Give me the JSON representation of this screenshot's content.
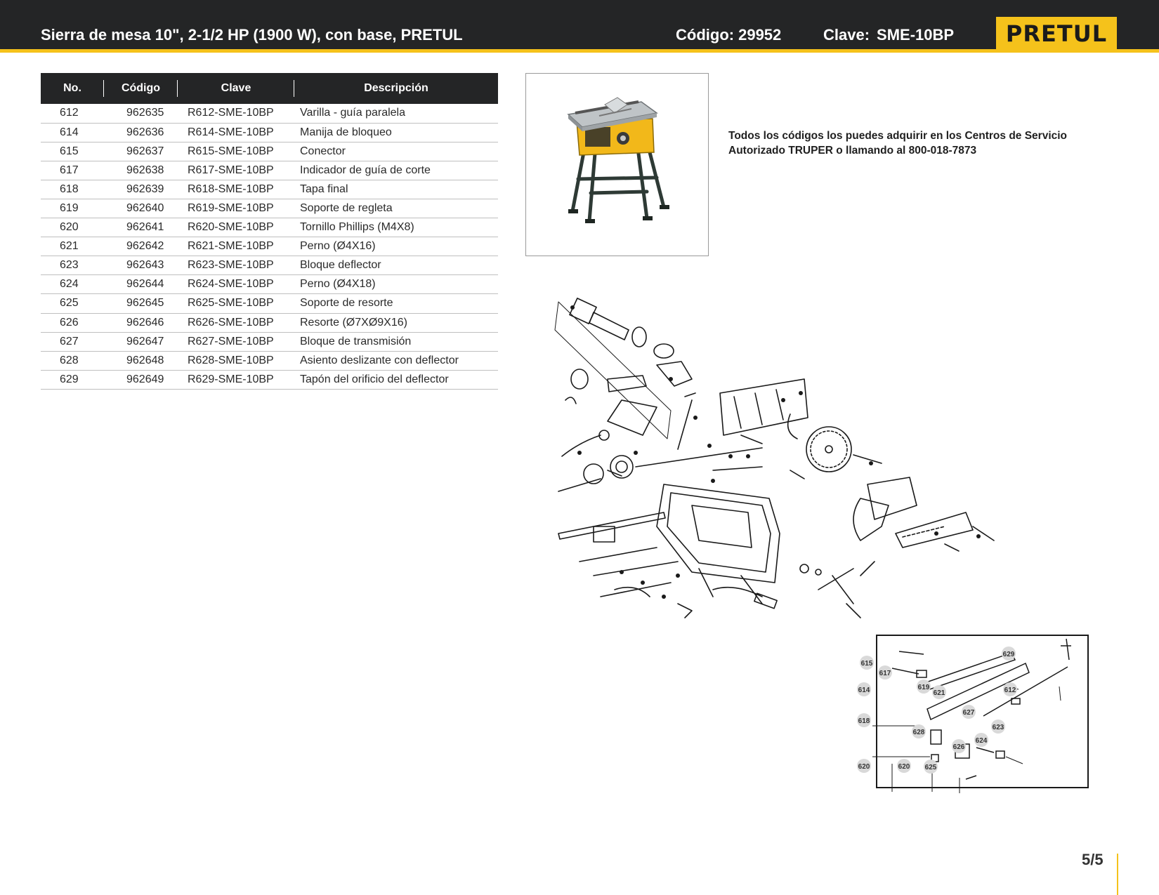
{
  "header": {
    "title": "Sierra de mesa 10\", 2-1/2 HP (1900 W), con base, PRETUL",
    "codigo_label": "Código:",
    "codigo_value": "29952",
    "clave_label": "Clave:",
    "clave_value": "SME-10BP",
    "logo": "PRETUL",
    "colors": {
      "bar": "#242526",
      "accent": "#f5c21b"
    }
  },
  "table": {
    "headers": [
      "No.",
      "Código",
      "Clave",
      "Descripción"
    ],
    "rows": [
      [
        "612",
        "962635",
        "R612-SME-10BP",
        "Varilla - guía paralela"
      ],
      [
        "614",
        "962636",
        "R614-SME-10BP",
        "Manija de bloqueo"
      ],
      [
        "615",
        "962637",
        "R615-SME-10BP",
        "Conector"
      ],
      [
        "617",
        "962638",
        "R617-SME-10BP",
        "Indicador de guía de corte"
      ],
      [
        "618",
        "962639",
        "R618-SME-10BP",
        "Tapa final"
      ],
      [
        "619",
        "962640",
        "R619-SME-10BP",
        "Soporte de regleta"
      ],
      [
        "620",
        "962641",
        "R620-SME-10BP",
        "Tornillo Phillips (M4X8)"
      ],
      [
        "621",
        "962642",
        "R621-SME-10BP",
        "Perno (Ø4X16)"
      ],
      [
        "623",
        "962643",
        "R623-SME-10BP",
        "Bloque deflector"
      ],
      [
        "624",
        "962644",
        "R624-SME-10BP",
        "Perno (Ø4X18)"
      ],
      [
        "625",
        "962645",
        "R625-SME-10BP",
        "Soporte de resorte"
      ],
      [
        "626",
        "962646",
        "R626-SME-10BP",
        "Resorte (Ø7XØ9X16)"
      ],
      [
        "627",
        "962647",
        "R627-SME-10BP",
        "Bloque de transmisión"
      ],
      [
        "628",
        "962648",
        "R628-SME-10BP",
        "Asiento deslizante con deflector"
      ],
      [
        "629",
        "962649",
        "R629-SME-10BP",
        "Tapón del orificio del deflector"
      ]
    ]
  },
  "note": "Todos los códigos los puedes adquirir en los Centros de Servicio Autorizado TRUPER o llamando al 800-018-7873",
  "inset_callouts": [
    "629",
    "615",
    "617",
    "612",
    "614",
    "619",
    "621",
    "627",
    "618",
    "623",
    "628",
    "624",
    "626",
    "620",
    "620",
    "625"
  ],
  "page": {
    "number": "5/5"
  }
}
